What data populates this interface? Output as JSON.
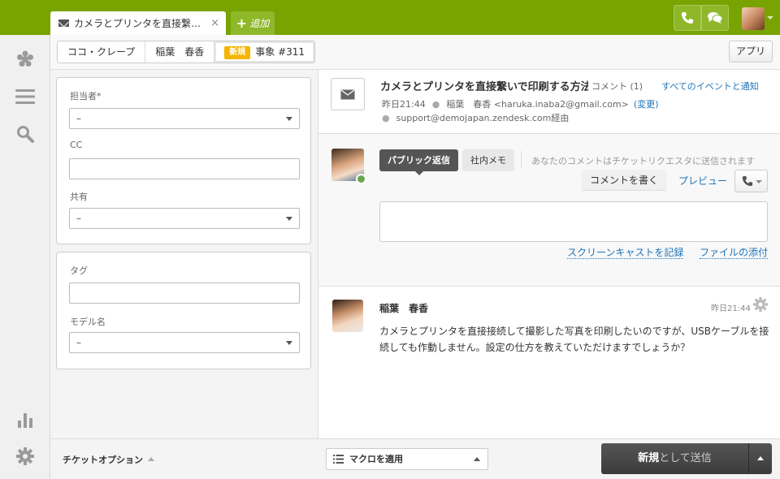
{
  "colors": {
    "brand": "#78a300",
    "link": "#1f73b7",
    "badge": "#f4b400",
    "dark_button": "#444444"
  },
  "tabs": {
    "ticket_tab": {
      "title": "カメラとプリンタを直接繋いで…",
      "icon": "mail-icon",
      "close": "×"
    },
    "add_label": "追加"
  },
  "topbar": {
    "phone_icon": "phone-icon",
    "chat_icon": "chat-bubbles-icon",
    "avatar": "user-avatar"
  },
  "nav": {
    "items": [
      "logo-icon",
      "views-icon",
      "search-icon",
      "reports-icon",
      "admin-gear-icon"
    ]
  },
  "breadcrumb": {
    "org": "ココ・クレープ",
    "requester": "稲葉　春香",
    "status_badge": "新規",
    "ticket": "事象 #311"
  },
  "header": {
    "apps_label": "アプリ"
  },
  "properties": {
    "assignee_label": "担当者*",
    "assignee_value": "–",
    "cc_label": "CC",
    "share_label": "共有",
    "share_value": "–",
    "tags_label": "タグ",
    "model_label": "モデル名",
    "model_value": "–"
  },
  "ticket": {
    "subject": "カメラとプリンタを直接繋いで印刷する方法",
    "comment_count": "コメント (1)",
    "all_events": "すべてのイベントと通知",
    "time": "昨日21:44",
    "requester": "稲葉　春香 <haruka.inaba2@gmail.com>",
    "change": "(変更)",
    "via": "support@demojapan.zendesk.com経由"
  },
  "composer": {
    "public_reply": "パブリック返信",
    "internal_note": "社内メモ",
    "note": "あなたのコメントはチケットリクエスタに送信されます",
    "write_comment": "コメントを書く",
    "preview": "プレビュー",
    "screencast": "スクリーンキャストを記録",
    "attach": "ファイルの添付"
  },
  "comment": {
    "author": "稲葉　春香",
    "time": "昨日21:44",
    "body": "カメラとプリンタを直接接続して撮影した写真を印刷したいのですが、USBケーブルを接続しても作動しません。設定の仕方を教えていただけますでしょうか？"
  },
  "footer": {
    "ticket_options": "チケットオプション",
    "macro": "マクロを適用",
    "submit_status": "新規",
    "submit_rest": "として送信"
  }
}
